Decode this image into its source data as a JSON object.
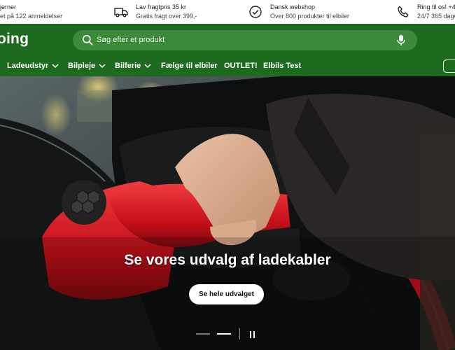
{
  "usp": [
    {
      "icon": "rating-icon",
      "line1": "jerner",
      "line2": "et på 122 anmeldelser"
    },
    {
      "icon": "truck-icon",
      "line1": "Lav fragtpris 35 kr",
      "line2": "Gratis fragt over 399,-"
    },
    {
      "icon": "check-circle-icon",
      "line1": "Dansk webshop",
      "line2": "Over 800 produkter til elbiler"
    },
    {
      "icon": "phone-icon",
      "line1": "Ring til os! +4",
      "line2": "24/7 365 dage"
    }
  ],
  "header": {
    "logo": "oing",
    "search_placeholder": "Søg efter et produkt"
  },
  "nav": {
    "items": [
      {
        "label": "Ladeudstyr",
        "dropdown": true
      },
      {
        "label": "Bilpleje",
        "dropdown": true
      },
      {
        "label": "Bilferie",
        "dropdown": true
      },
      {
        "label": "Fælge til elbiler",
        "dropdown": false
      },
      {
        "label": "OUTLET!",
        "dropdown": false
      },
      {
        "label": "Elbils Test",
        "dropdown": false
      }
    ]
  },
  "hero": {
    "title": "Se vores udvalg af ladekabler",
    "button_label": "Se hele udvalget",
    "slide_count": 3,
    "active_slide": 2
  },
  "colors": {
    "brand_green": "#1d6b1f",
    "search_green": "#3d8a3b",
    "connector_red": "#d4141b"
  }
}
